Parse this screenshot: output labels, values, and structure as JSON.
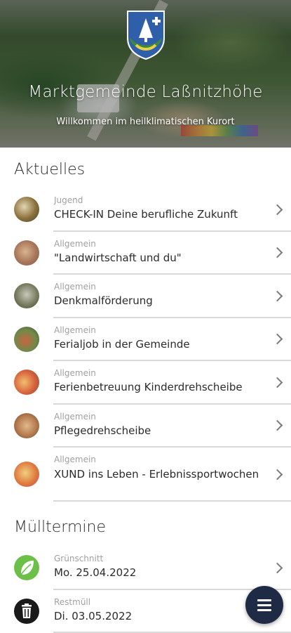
{
  "hero": {
    "title": "Marktgemeinde Laßnitzhöhe",
    "subtitle": "Willkommen im heilklimatischen Kurort"
  },
  "aktuelles": {
    "heading": "Aktuelles",
    "items": [
      {
        "category": "Jugend",
        "title": "CHECK-IN Deine berufliche Zukunft",
        "thumb": "jugend-thumbnail"
      },
      {
        "category": "Allgemein",
        "title": "\"Landwirtschaft und du\"",
        "thumb": "landwirtschaft-thumbnail"
      },
      {
        "category": "Allgemein",
        "title": "Denkmalförderung",
        "thumb": "denkmal-thumbnail"
      },
      {
        "category": "Allgemein",
        "title": "Ferialjob in der Gemeinde",
        "thumb": "ferialjob-thumbnail"
      },
      {
        "category": "Allgemein",
        "title": "Ferienbetreuung Kinderdrehscheibe",
        "thumb": "ferienbetreuung-thumbnail"
      },
      {
        "category": "Allgemein",
        "title": "Pflegedrehscheibe",
        "thumb": "pflege-thumbnail"
      },
      {
        "category": "Allgemein",
        "title": "XUND ins Leben - Erlebnissportwochen",
        "thumb": "xund-thumbnail"
      }
    ]
  },
  "muell": {
    "heading": "Mülltermine",
    "items": [
      {
        "category": "Grünschnitt",
        "title": "Mo. 25.04.2022",
        "icon": "leaf-icon"
      },
      {
        "category": "Restmüll",
        "title": "Di. 03.05.2022",
        "icon": "trash-icon"
      }
    ]
  },
  "colors": {
    "fab": "#1f2a44",
    "leaf_badge": "#6cc04a",
    "trash_badge": "#1a1a1a"
  },
  "fab_icon": "menu-icon"
}
